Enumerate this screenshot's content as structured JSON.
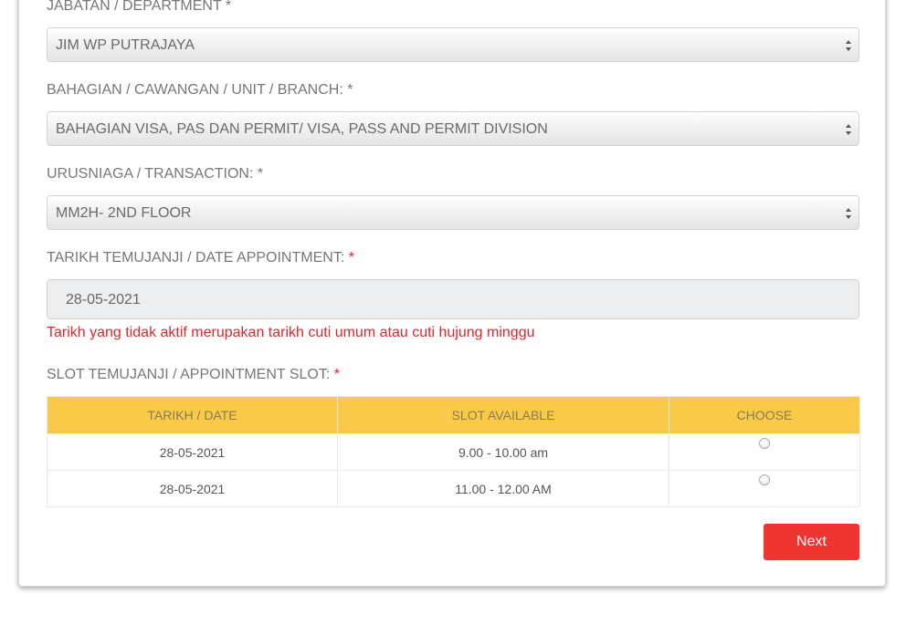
{
  "form": {
    "department": {
      "label": "JABATAN / DEPARTMENT *",
      "value": "JIM WP PUTRAJAYA"
    },
    "branch": {
      "label": "BAHAGIAN / CAWANGAN / UNIT / BRANCH: *",
      "value": "BAHAGIAN VISA, PAS DAN PERMIT/ VISA, PASS AND PERMIT DIVISION"
    },
    "transaction": {
      "label": "URUSNIAGA / TRANSACTION: *",
      "value": "MM2H- 2ND FLOOR"
    },
    "date_appointment": {
      "label": "TARIKH TEMUJANJI / DATE APPOINTMENT:",
      "required_mark": "*",
      "value": "28-05-2021",
      "notice": "Tarikh yang tidak aktif merupakan tarikh cuti umum atau cuti hujung minggu"
    },
    "appointment_slot": {
      "label": "SLOT TEMUJANJI / APPOINTMENT SLOT:",
      "required_mark": "*",
      "columns": [
        "TARIKH / DATE",
        "SLOT AVAILABLE",
        "CHOOSE"
      ],
      "rows": [
        {
          "date": "28-05-2021",
          "slot": "9.00 - 10.00 am"
        },
        {
          "date": "28-05-2021",
          "slot": "11.00 - 12.00 AM"
        }
      ]
    },
    "next_label": "Next"
  },
  "colors": {
    "accent_red": "#ee3530",
    "header_yellow": "#f9ca47",
    "notice_red": "#d7282f"
  },
  "icons": {
    "select_arrow": "updown-chevron-icon",
    "radio": "radio-button-icon"
  }
}
